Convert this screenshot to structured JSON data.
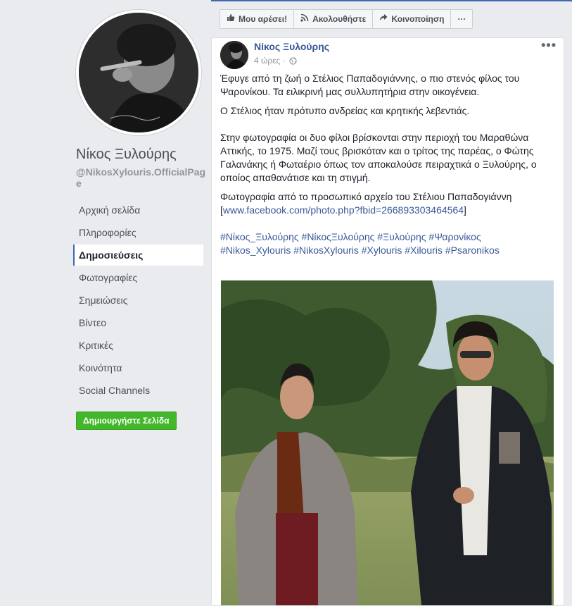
{
  "page": {
    "name": "Νίκος Ξυλούρης",
    "handle": "@NikosXylouris.OfficialPage"
  },
  "nav": [
    {
      "label": "Αρχική σελίδα",
      "active": false
    },
    {
      "label": "Πληροφορίες",
      "active": false
    },
    {
      "label": "Δημοσιεύσεις",
      "active": true
    },
    {
      "label": "Φωτογραφίες",
      "active": false
    },
    {
      "label": "Σημειώσεις",
      "active": false
    },
    {
      "label": "Βίντεο",
      "active": false
    },
    {
      "label": "Κριτικές",
      "active": false
    },
    {
      "label": "Κοινότητα",
      "active": false
    },
    {
      "label": "Social Channels",
      "active": false
    }
  ],
  "create_page_label": "Δημιουργήστε Σελίδα",
  "actions": {
    "like": "Μου αρέσει!",
    "follow": "Ακολουθήστε",
    "share": "Κοινοποίηση",
    "more": "···"
  },
  "post": {
    "author": "Νίκος Ξυλούρης",
    "time": "4 ώρες ·",
    "p1": "Έφυγε από τη ζωή ο Στέλιος Παπαδογιάννης, ο πιο στενός φίλος του Ψαρονίκου. Τα ειλικρινή μας συλλυπητήρια στην οικογένεια.",
    "p2": "Ο Στέλιος ήταν πρότυπο ανδρείας και κρητικής λεβεντιάς.",
    "p3": "Στην φωτογραφία οι δυο φίλοι βρίσκονται στην περιοχή του Μαραθώνα Αττικής, το 1975. Μαζί τους βρισκόταν και ο τρίτος της παρέας, ο Φώτης Γαλανάκης ή Φωταέριο όπως τον αποκαλούσε πειραχτικά ο Ξυλούρης, ο οποίος απαθανάτισε και τη στιγμή.",
    "p4_text": "Φωτογραφία από το προσωπικό αρχείο του Στέλιου Παπαδογιάννη",
    "p4_link_open": "[",
    "p4_link": "www.facebook.com/photo.php?fbid=266893303464564",
    "p4_link_close": "]",
    "hashtags1": "#Νίκος_Ξυλούρης #ΝίκοςΞυλούρης #Ξυλούρης #Ψαρονίκος",
    "hashtags2": "#Nikos_Xylouris #NikosXylouris #Xylouris #Xilouris #Psaronikos"
  },
  "icons": {
    "like": "thumbs-up-icon",
    "follow": "rss-icon",
    "share": "share-arrow-icon",
    "privacy": "globe-icon"
  },
  "colors": {
    "brand": "#4267b2",
    "link": "#385898",
    "create_button": "#42b72a"
  }
}
